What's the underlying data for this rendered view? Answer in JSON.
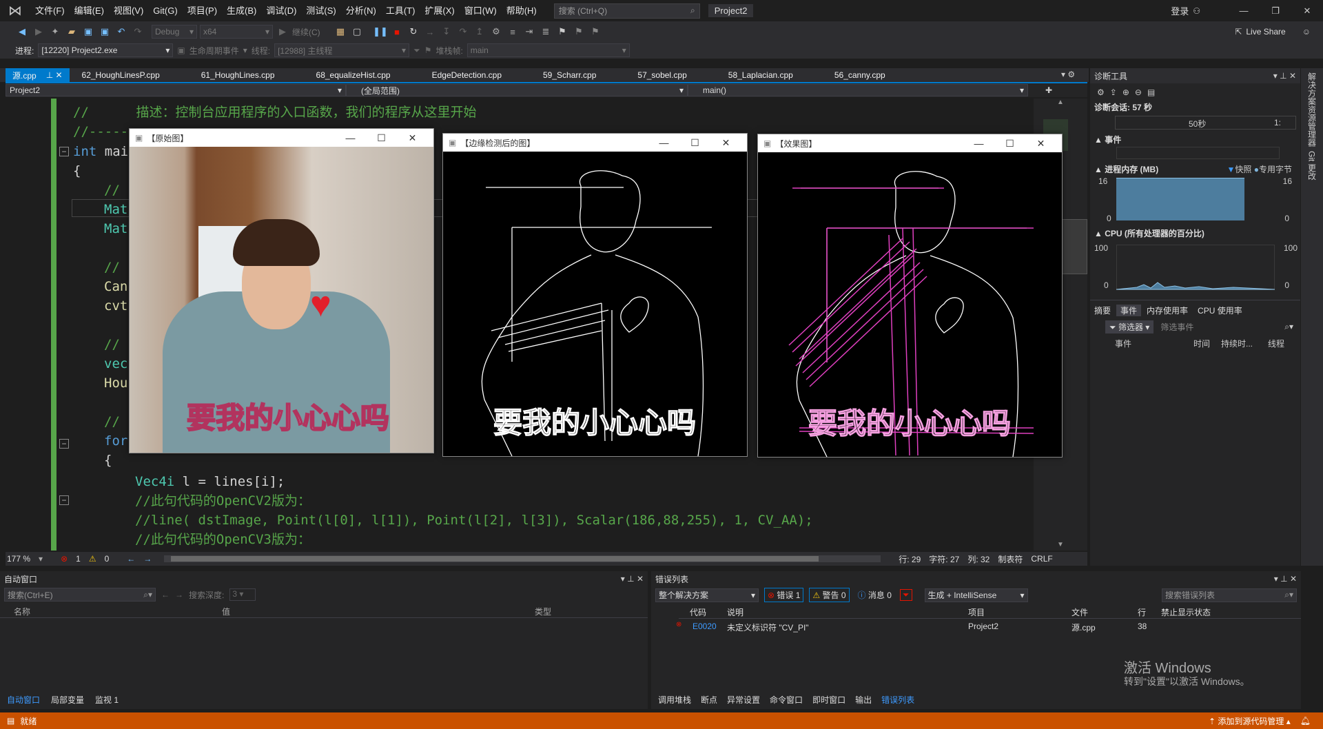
{
  "menu": {
    "items": [
      "文件(F)",
      "编辑(E)",
      "视图(V)",
      "Git(G)",
      "项目(P)",
      "生成(B)",
      "调试(D)",
      "测试(S)",
      "分析(N)",
      "工具(T)",
      "扩展(X)",
      "窗口(W)",
      "帮助(H)"
    ],
    "search_placeholder": "搜索 (Ctrl+Q)",
    "solution": "Project2",
    "login": "登录"
  },
  "toolbar": {
    "config": "Debug",
    "platform": "x64",
    "continue": "继续(C)",
    "live_share": "Live Share"
  },
  "toolbar2": {
    "process_label": "进程:",
    "process_value": "[12220] Project2.exe",
    "lifecycle": "生命周期事件",
    "thread_label": "线程:",
    "thread_value": "[12988] 主线程",
    "stack_label": "堆栈帧:",
    "stack_value": "main"
  },
  "tabs": [
    "源.cpp",
    "62_HoughLinesP.cpp",
    "61_HoughLines.cpp",
    "68_equalizeHist.cpp",
    "EdgeDetection.cpp",
    "59_Scharr.cpp",
    "57_sobel.cpp",
    "58_Laplacian.cpp",
    "56_canny.cpp"
  ],
  "navbar": {
    "project": "Project2",
    "scope": "(全局范围)",
    "member": "main()"
  },
  "code": {
    "l1": "//      描述：控制台应用程序的入口函数，我们的程序从这里开始",
    "l2": "//------",
    "l3a": "int",
    "l3b": " mai",
    "l4": "{",
    "l5": "// I",
    "l6": "Mat",
    "l7": "Mat",
    "l8": "// I",
    "l9": "Can",
    "l10": "cvt",
    "l11": "// I",
    "l12": "vec",
    "l13": "Hou",
    "l14": "// I",
    "l15": "for",
    "l16": "{",
    "l17a": "Vec4i",
    "l17b": " l = lines[i];",
    "l18": "//此句代码的OpenCV2版为：",
    "l19": "//line( dstImage, Point(l[0], l[1]), Point(l[2], l[3]), Scalar(186,88,255), 1, CV_AA);",
    "l20": "//此句代码的OpenCV3版为："
  },
  "editor_status": {
    "zoom": "177 %",
    "errors": "1",
    "warnings": "0",
    "line": "行: 29",
    "char": "字符: 27",
    "col": "列: 32",
    "tabs": "制表符",
    "eol": "CRLF"
  },
  "windows": {
    "original": "【原始图】",
    "edges": "【边缘检测后的图】",
    "result": "【效果图】",
    "caption": "要我的小心心吗"
  },
  "diag": {
    "title": "诊断工具",
    "session": "诊断会话: 57 秒",
    "timeline_tick": "50秒",
    "timeline_end": "1:",
    "events": "事件",
    "memory": "进程内存 (MB)",
    "snapshot": "快照",
    "private_bytes": "专用字节",
    "mem_max": "16",
    "mem_min": "0",
    "cpu": "CPU (所有处理器的百分比)",
    "cpu_max": "100",
    "cpu_min": "0",
    "tabs": [
      "摘要",
      "事件",
      "内存使用率",
      "CPU 使用率"
    ],
    "filter": "筛选器",
    "filter_placeholder": "筛选事件",
    "cols": [
      "事件",
      "时间",
      "持续时...",
      "线程"
    ]
  },
  "side": {
    "a": "解决方案资源管理器",
    "b": "Git 更改"
  },
  "autos": {
    "title": "自动窗口",
    "search": "搜索(Ctrl+E)",
    "depth_label": "搜索深度:",
    "depth": "3",
    "cols": [
      "名称",
      "值",
      "类型"
    ],
    "tabs": [
      "自动窗口",
      "局部变量",
      "监视 1"
    ]
  },
  "errors": {
    "title": "错误列表",
    "scope": "整个解决方案",
    "err": "错误 1",
    "warn": "警告 0",
    "msg": "消息 0",
    "build": "生成 + IntelliSense",
    "search": "搜索错误列表",
    "cols": [
      "代码",
      "说明",
      "项目",
      "文件",
      "行",
      "禁止显示状态"
    ],
    "row": {
      "code": "E0020",
      "desc": "未定义标识符 \"CV_PI\"",
      "project": "Project2",
      "file": "源.cpp",
      "line": "38"
    },
    "tabs": [
      "调用堆栈",
      "断点",
      "异常设置",
      "命令窗口",
      "即时窗口",
      "输出",
      "错误列表"
    ],
    "watermark1": "激活 Windows",
    "watermark2": "转到\"设置\"以激活 Windows。"
  },
  "status": {
    "ready": "就绪",
    "source_control": "添加到源代码管理"
  }
}
